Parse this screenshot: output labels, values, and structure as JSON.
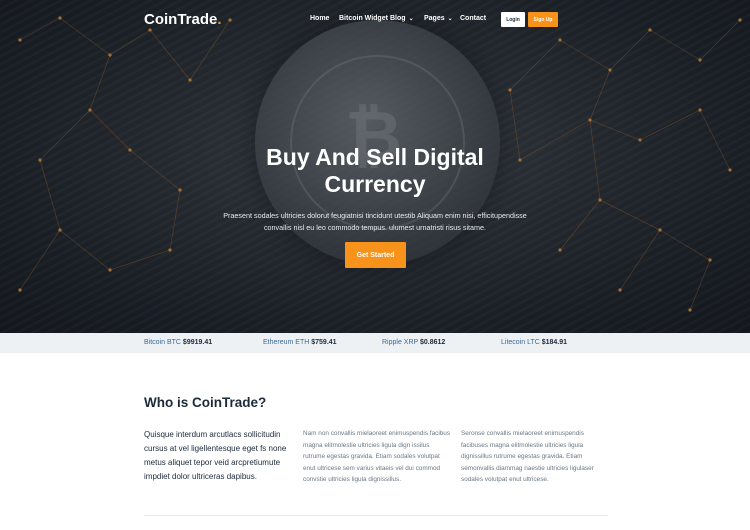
{
  "brand": {
    "name": "CoinTrade",
    "dot": ".",
    "accent_color": "#f7931a"
  },
  "nav": {
    "items": [
      {
        "label": "Home",
        "has_dropdown": false
      },
      {
        "label": "Bitcoin Widget",
        "has_dropdown": false
      },
      {
        "label": "Blog",
        "has_dropdown": true
      },
      {
        "label": "Pages",
        "has_dropdown": true
      },
      {
        "label": "Contact",
        "has_dropdown": false
      }
    ],
    "login_label": "Login",
    "signup_label": "Sign Up"
  },
  "hero": {
    "title_line1": "Buy And Sell Digital",
    "title_line2": "Currency",
    "text": "Praesent sodales ultricies dolorut feugiatnisi tincidunt utestib Aliquam enim nisi, efficitupendisse convallis nisl eu leo commodo tempus. ulumest urnatristi risus sitame.",
    "cta_label": "Get Started"
  },
  "ticker": [
    {
      "name": "Bitcoin BTC",
      "price": "$9919.41"
    },
    {
      "name": "Ethereum ETH",
      "price": "$759.41"
    },
    {
      "name": "Ripple XRP",
      "price": "$0.8612"
    },
    {
      "name": "Litecoin LTC",
      "price": "$184.91"
    }
  ],
  "about": {
    "title": "Who is CoinTrade?",
    "lead": "Quisque interdum arcutlacs sollicitudin cursus at vel ligellentesque eget fs none metus aliquet tepor veid arcpretiumute impdiet dolor ultriceras dapibus.",
    "col1": "Nam non convallis mielaoreet enimuspendis facibus magna elitmolestie ultricies ligula dign issilus rutrume egestas gravida. Etiam sodales volutpat enut ultricese sem varius vitaeis vel dui commod convstie ultricies ligula dignissillus.",
    "col2": "Seronse convallis mielaoreet enimuspendis facibuses magna elitmolestie ultricies ligula dignissillus rutrume egestas gravida. Etiam semonvallis diammag naestie ultricies ligulaser sodales volutpat enut ultricese."
  }
}
